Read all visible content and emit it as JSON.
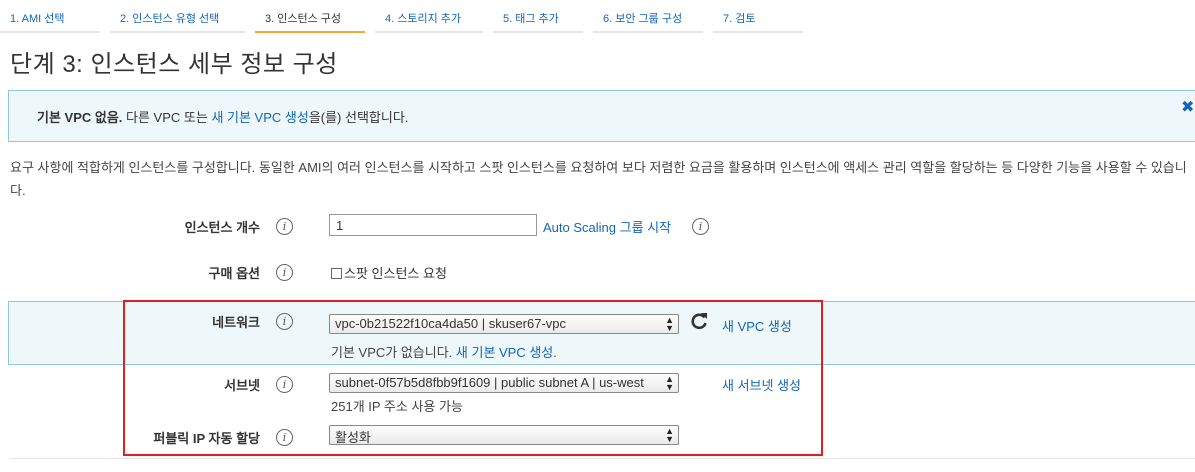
{
  "wizard": {
    "steps": [
      {
        "label": "1. AMI 선택"
      },
      {
        "label": "2. 인스턴스 유형 선택"
      },
      {
        "label": "3. 인스턴스 구성"
      },
      {
        "label": "4. 스토리지 추가"
      },
      {
        "label": "5. 태그 추가"
      },
      {
        "label": "6. 보안 그룹 구성"
      },
      {
        "label": "7. 검토"
      }
    ],
    "active_step": 3
  },
  "page": {
    "title": "단계 3: 인스턴스 세부 정보 구성"
  },
  "banner": {
    "bold": "기본 VPC 없음.",
    "pre": " 다른 VPC 또는 ",
    "link": "새 기본 VPC 생성",
    "post": "을(를) 선택합니다.",
    "close_icon": "close-icon"
  },
  "description": "요구 사항에 적합하게 인스턴스를 구성합니다. 동일한 AMI의 여러 인스턴스를 시작하고 스팟 인스턴스를 요청하여 보다 저렴한 요금을 활용하며 인스턴스에 액세스 관리 역할을 할당하는 등 다양한 기능을 사용할 수 있습니다.",
  "form": {
    "instance_count": {
      "label": "인스턴스 개수",
      "value": "1",
      "link": "Auto Scaling 그룹 시작"
    },
    "purchase_option": {
      "label": "구매 옵션",
      "checkbox_label": "스팟 인스턴스 요청",
      "checked": false
    },
    "network": {
      "label": "네트워크",
      "selected": "vpc-0b21522f10ca4da50 | skuser67-vpc",
      "create_link": "새 VPC 생성",
      "hint_text": "기본 VPC가 없습니다. ",
      "hint_link": "새 기본 VPC 생성",
      "hint_dot": "."
    },
    "subnet": {
      "label": "서브넷",
      "selected": "subnet-0f57b5d8fbb9f1609 | public subnet A | us-west",
      "create_link": "새 서브넷 생성",
      "hint": "251개 IP 주소 사용 가능"
    },
    "public_ip": {
      "label": "퍼블릭 IP 자동 할당",
      "selected": "활성화"
    }
  },
  "colors": {
    "link": "#1166bb",
    "active_tab": "#f0a830",
    "info_bg": "#eef7fa",
    "highlight": "#e02020"
  }
}
